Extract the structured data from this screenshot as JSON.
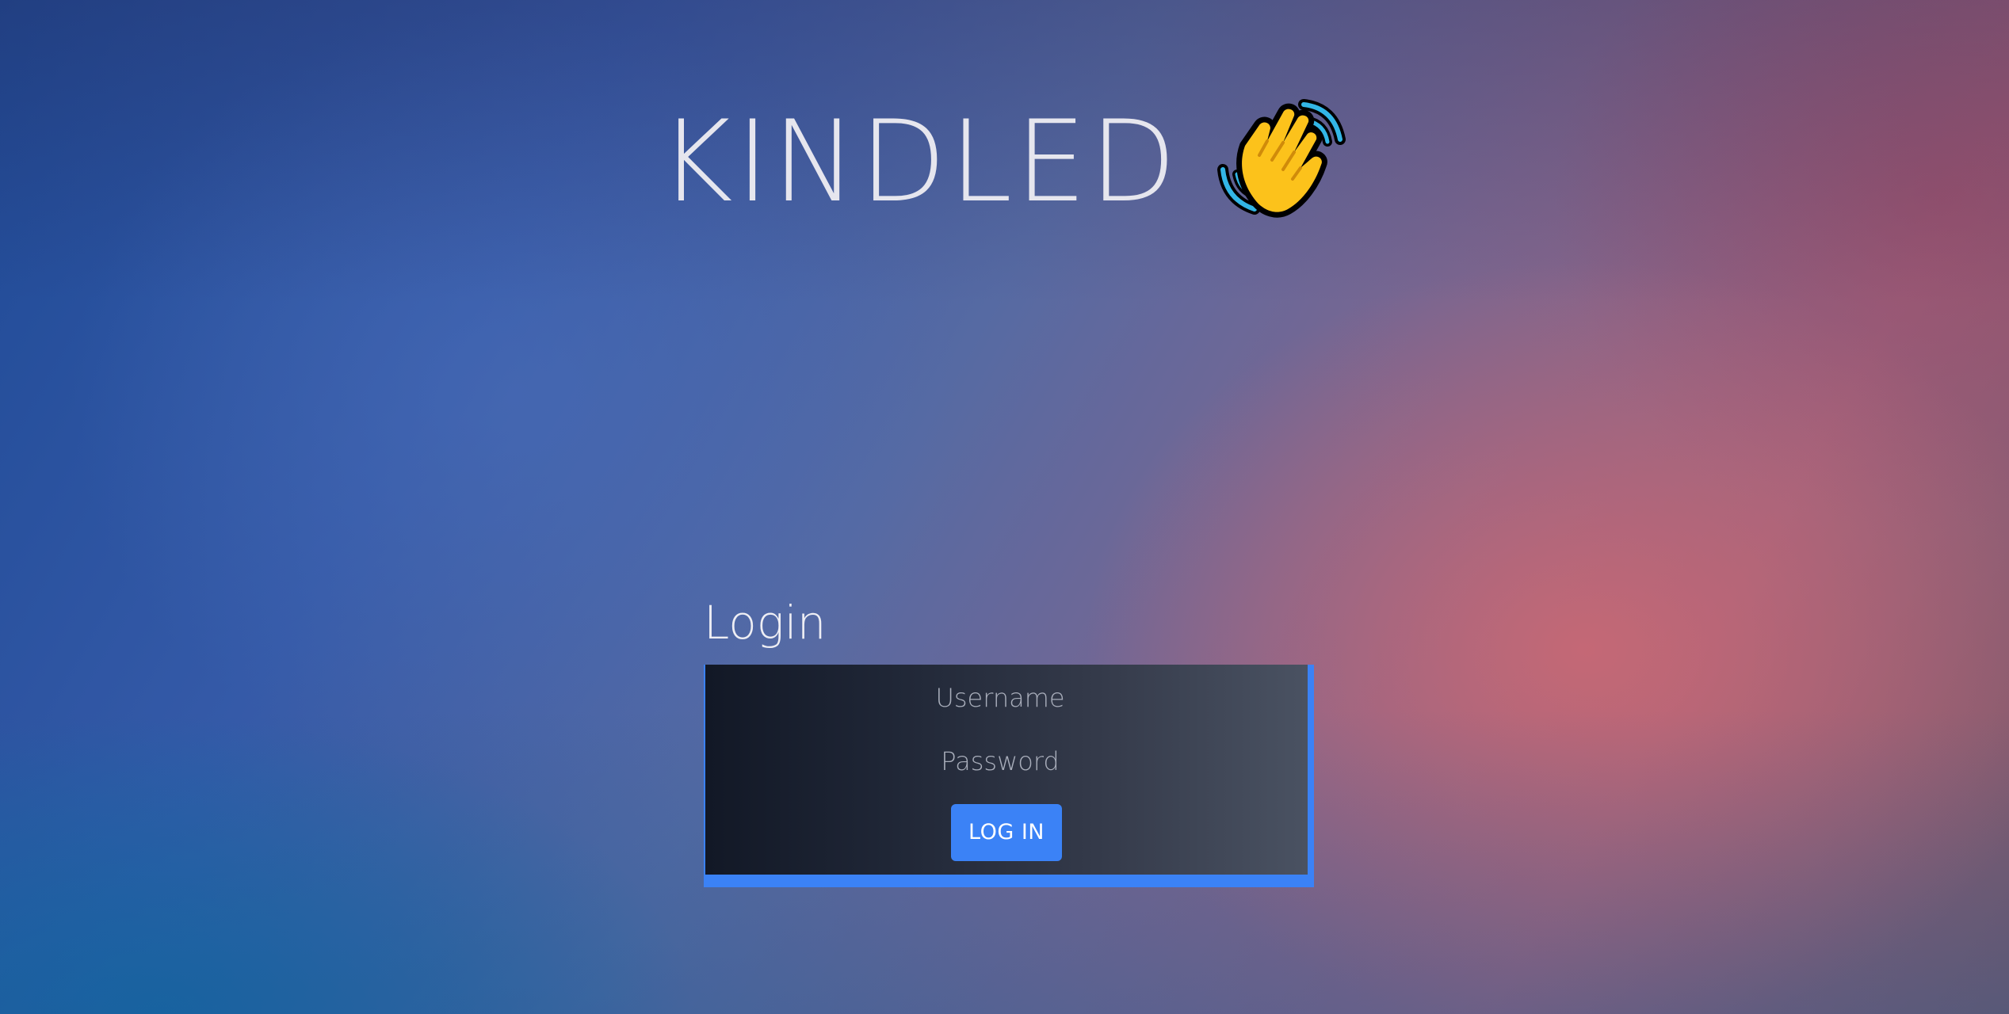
{
  "app": {
    "title": "KINDLED",
    "title_icon": "waving-hand-icon"
  },
  "login": {
    "heading": "Login",
    "username_placeholder": "Username",
    "password_placeholder": "Password",
    "submit_label": "LOG IN"
  },
  "colors": {
    "accent": "#3b82f6",
    "card_dark": "#121826",
    "card_light": "#4a5262",
    "title_text": "#e6e6ee",
    "placeholder_text": "#a9aebb"
  }
}
